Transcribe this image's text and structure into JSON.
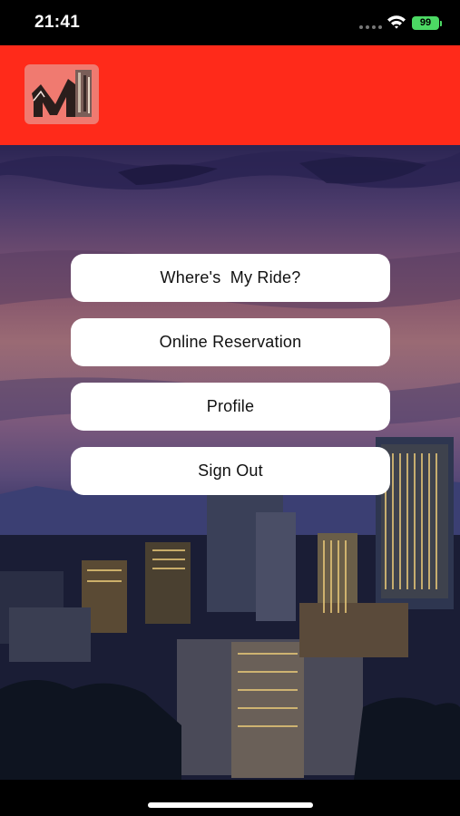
{
  "status_bar": {
    "time": "21:41",
    "battery_level": "99",
    "battery_color": "#4cd964",
    "icons": [
      "signal-icon",
      "wifi-icon",
      "battery-charging-icon"
    ]
  },
  "header": {
    "background_color": "#ff2a1a",
    "logo_icon": "m-building-logo-icon"
  },
  "menu": {
    "buttons": [
      {
        "label": "Where's  My Ride?"
      },
      {
        "label": "Online Reservation"
      },
      {
        "label": "Profile"
      },
      {
        "label": "Sign Out"
      }
    ]
  },
  "background": {
    "description_icon": "city-skyline-at-dusk-image"
  }
}
